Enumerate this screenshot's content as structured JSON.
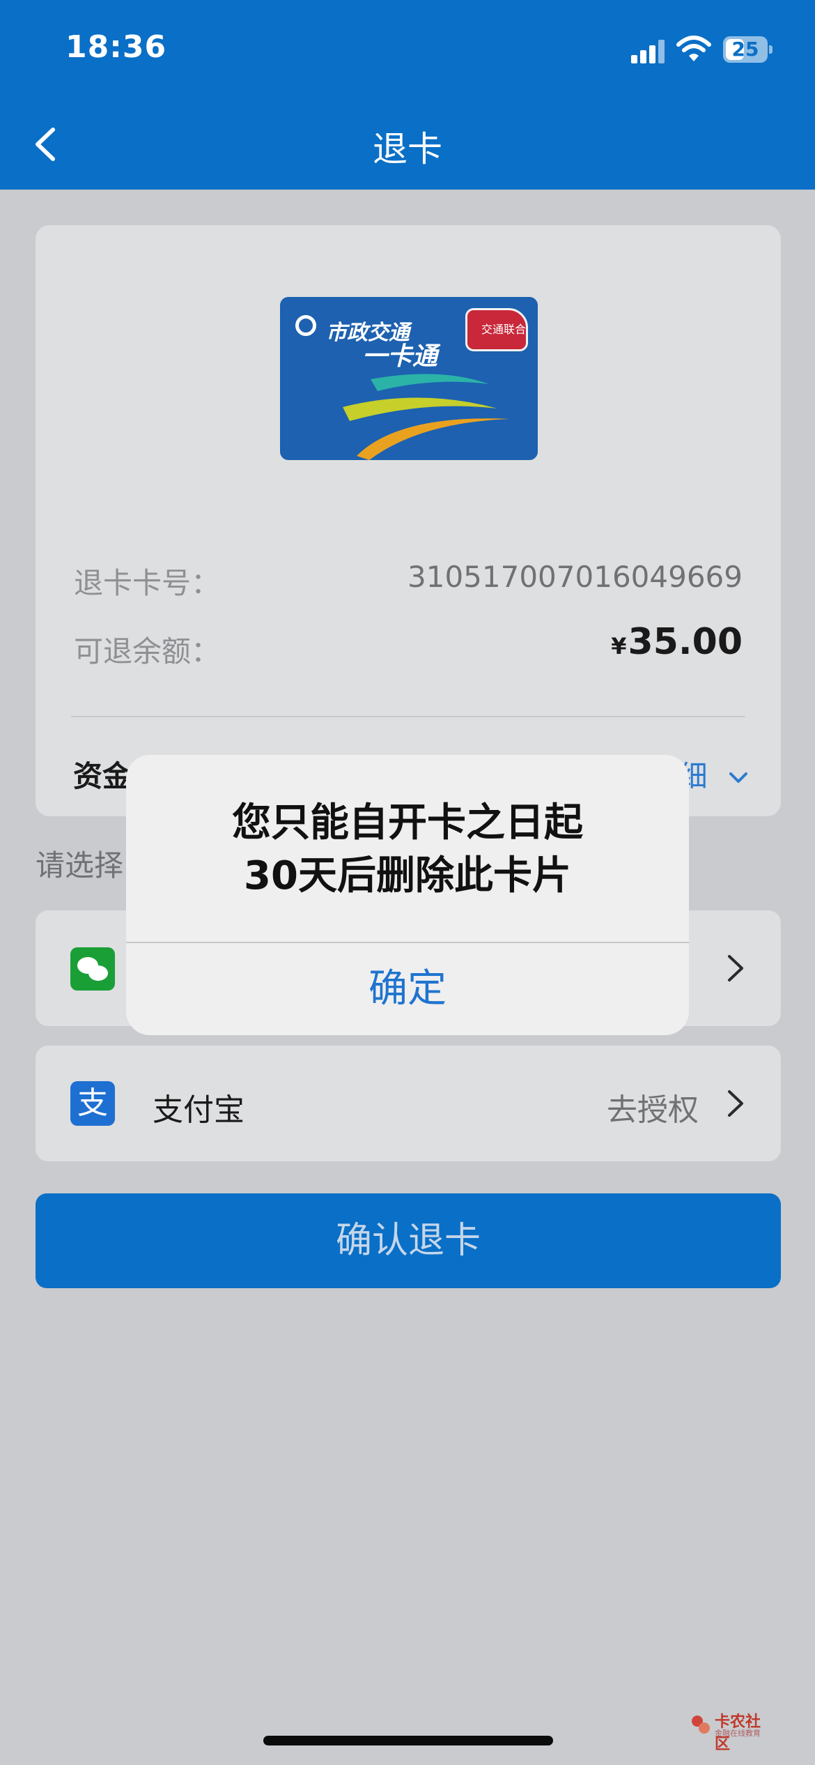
{
  "status_bar": {
    "time": "18:36",
    "battery": "25"
  },
  "nav": {
    "title": "退卡"
  },
  "card": {
    "image_brand_text": "市政交通",
    "image_title_text": "一卡通",
    "image_badge_text": "交通联合",
    "card_number_label": "退卡卡号：",
    "card_number_value": "310517007016049669",
    "balance_label": "可退余额：",
    "balance_currency": "¥",
    "balance_value": "35.00",
    "fund_label": "资金",
    "detail_link": "明细"
  },
  "section_label": "请选择",
  "payment_methods": [
    {
      "name": "",
      "action": ""
    },
    {
      "name": "支付宝",
      "action": "去授权"
    }
  ],
  "confirm_button": "确认退卡",
  "alert": {
    "line1": "您只能自开卡之日起",
    "line2": "30天后删除此卡片",
    "ok": "确定"
  },
  "watermark": {
    "text": "卡农社区",
    "sub": "金融在线教育"
  },
  "colors": {
    "brand_blue": "#0a6fc6",
    "link_blue": "#1f74cf",
    "wechat_green": "#1a9f37",
    "alipay_blue": "#1e6fd2"
  }
}
